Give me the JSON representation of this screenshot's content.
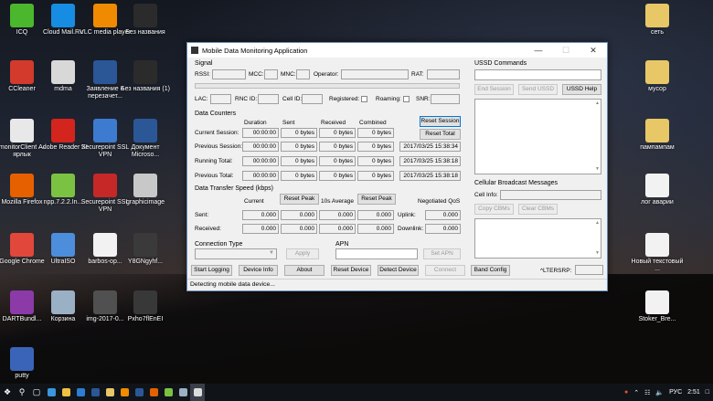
{
  "desktop": {
    "left_icons": [
      {
        "label": "ICQ",
        "icon": "icq-icon",
        "color": "#4bb72c"
      },
      {
        "label": "Cloud Mail.Ru",
        "icon": "cloud-icon",
        "color": "#168de2"
      },
      {
        "label": "VLC media player",
        "icon": "vlc-icon",
        "color": "#f08a00"
      },
      {
        "label": "Без названия",
        "icon": "image-icon",
        "color": "#2b2b2b"
      },
      {
        "label": "CCleaner",
        "icon": "ccleaner-icon",
        "color": "#d33a2c"
      },
      {
        "label": "mdma",
        "icon": "file-icon",
        "color": "#d8d8d8"
      },
      {
        "label": "Заявление о перезачет...",
        "icon": "word-icon",
        "color": "#2b5797"
      },
      {
        "label": "Без названия (1)",
        "icon": "image-icon",
        "color": "#2b2b2b"
      },
      {
        "label": "monitorClient — ярлык",
        "icon": "monitor-icon",
        "color": "#e8e8e8"
      },
      {
        "label": "Adobe Reader XI",
        "icon": "pdf-icon",
        "color": "#d3251d"
      },
      {
        "label": "Securepoint SSL VPN",
        "icon": "vpn-icon",
        "color": "#3d7bd0"
      },
      {
        "label": "Документ Microso...",
        "icon": "word-icon",
        "color": "#2b5797"
      },
      {
        "label": "Mozilla Firefox",
        "icon": "firefox-icon",
        "color": "#e66000"
      },
      {
        "label": "npp.7.2.2.In...",
        "icon": "notepadpp-icon",
        "color": "#7cc242"
      },
      {
        "label": "Securepoint SSL VPN",
        "icon": "shield-icon",
        "color": "#c62828"
      },
      {
        "label": "graphicimage",
        "icon": "image-icon",
        "color": "#c8c8c8"
      },
      {
        "label": "Google Chrome",
        "icon": "chrome-icon",
        "color": "#e1473b"
      },
      {
        "label": "UltraISO",
        "icon": "disc-icon",
        "color": "#4c8ddc"
      },
      {
        "label": "barbos-op...",
        "icon": "file-icon",
        "color": "#f2f2f2"
      },
      {
        "label": "Y8GNgyhf...",
        "icon": "image-icon",
        "color": "#3a3a3a"
      },
      {
        "label": "DARTBundl...",
        "icon": "archive-icon",
        "color": "#8b3aa8"
      },
      {
        "label": "Корзина",
        "icon": "recycle-bin-icon",
        "color": "#9ab0c4"
      },
      {
        "label": "img-2017-0...",
        "icon": "image-icon",
        "color": "#505050"
      },
      {
        "label": "Pxho7flEnEI",
        "icon": "image-icon",
        "color": "#383838"
      },
      {
        "label": "putty",
        "icon": "putty-icon",
        "color": "#3a64b8"
      }
    ],
    "right_icons": [
      {
        "label": "сеть",
        "icon": "folder-icon",
        "color": "#e8c766"
      },
      {
        "label": "мусор",
        "icon": "folder-icon",
        "color": "#e8c766"
      },
      {
        "label": "пампампам",
        "icon": "folder-icon",
        "color": "#e8c766"
      },
      {
        "label": "лог аварии",
        "icon": "file-icon",
        "color": "#f2f2f2"
      },
      {
        "label": "Новый текстовый ...",
        "icon": "file-icon",
        "color": "#f2f2f2"
      },
      {
        "label": "Stoker_Bre...",
        "icon": "file-icon",
        "color": "#f2f2f2"
      }
    ]
  },
  "window": {
    "title": "Mobile Data Monitoring Application",
    "signal": {
      "group": "Signal",
      "rssi": "RSSI:",
      "mcc": "MCC:",
      "mnc": "MNC:",
      "operator": "Operator:",
      "rat": "RAT:",
      "lac": "LAC:",
      "rnc": "RNC ID:",
      "cell": "Cell ID:",
      "registered": "Registered:",
      "roaming": "Roaming:",
      "snr": "SNR:"
    },
    "counters": {
      "group": "Data Counters",
      "headers": [
        "Duration",
        "Sent",
        "Received",
        "Combined"
      ],
      "reset_session": "Reset Session",
      "reset_total": "Reset Total",
      "rows": [
        {
          "label": "Current Session:",
          "duration": "00:00:00",
          "sent": "0 bytes",
          "received": "0 bytes",
          "combined": "0 bytes",
          "extra": ""
        },
        {
          "label": "Previous Session:",
          "duration": "00:00:00",
          "sent": "0 bytes",
          "received": "0 bytes",
          "combined": "0 bytes",
          "extra": "2017/03/25 15:38:34"
        },
        {
          "label": "Running Total:",
          "duration": "00:00:00",
          "sent": "0 bytes",
          "received": "0 bytes",
          "combined": "0 bytes",
          "extra": "2017/03/25 15:38:18"
        },
        {
          "label": "Previous Total:",
          "duration": "00:00:00",
          "sent": "0 bytes",
          "received": "0 bytes",
          "combined": "0 bytes",
          "extra": "2017/03/25 15:38:18"
        }
      ]
    },
    "speed": {
      "group": "Data Transfer Speed (kbps)",
      "current": "Current",
      "reset_peak": "Reset Peak",
      "avg": "10s Average",
      "qos": "Negotiated QoS",
      "sent_label": "Sent:",
      "received_label": "Received:",
      "sent": [
        "0.000",
        "0.000",
        "0.000",
        "0.000"
      ],
      "received": [
        "0.000",
        "0.000",
        "0.000",
        "0.000"
      ],
      "uplink_label": "Uplink:",
      "uplink": "0.000",
      "downlink_label": "Downlink:",
      "downlink": "0.000"
    },
    "connection": {
      "group": "Connection Type",
      "apply": "Apply",
      "apn_group": "APN",
      "set_apn": "Set APN"
    },
    "ussd": {
      "group": "USSD Commands",
      "end": "End Session",
      "send": "Send USSD",
      "help": "USSD Help"
    },
    "cbm": {
      "group": "Cellular Broadcast Messages",
      "cell_info": "Cell Info:",
      "copy": "Copy CBMs",
      "clear": "Clear CBMs"
    },
    "bottom": {
      "start_logging": "Start Logging",
      "device_info": "Device Info",
      "about": "About",
      "reset_device": "Reset Device",
      "detect_device": "Detect Device",
      "connect": "Connect",
      "band_config": "Band Config",
      "ltersrp": "^LTERSRP:"
    },
    "status": "Detecting mobile data device..."
  },
  "taskbar": {
    "language": "РУС",
    "time": "2:51"
  }
}
